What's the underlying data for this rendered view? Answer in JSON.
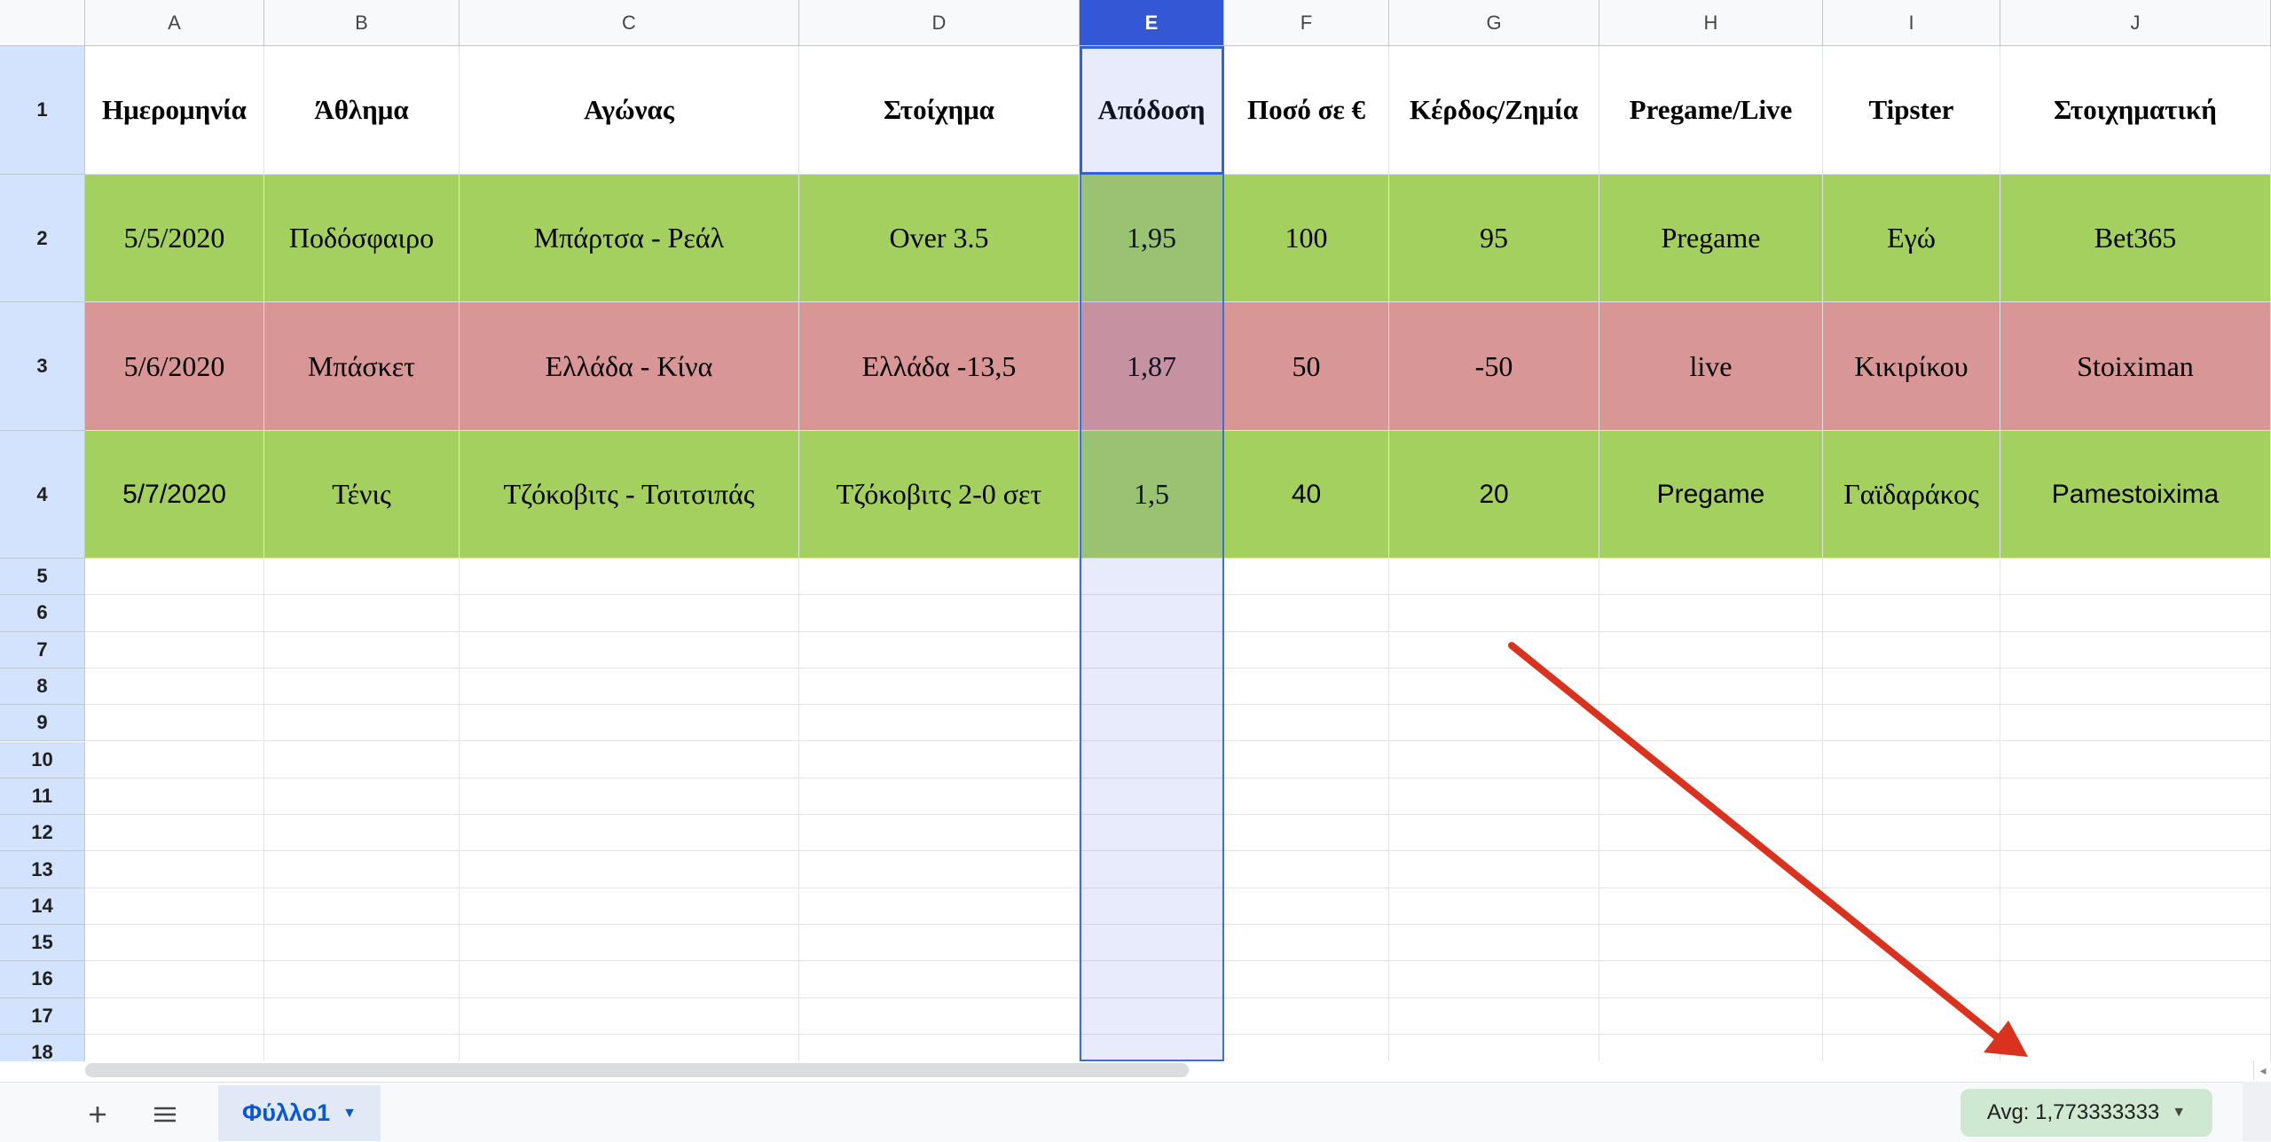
{
  "spreadsheet": {
    "columns": [
      {
        "letter": "A",
        "selected": false
      },
      {
        "letter": "B",
        "selected": false
      },
      {
        "letter": "C",
        "selected": false
      },
      {
        "letter": "D",
        "selected": false
      },
      {
        "letter": "E",
        "selected": true
      },
      {
        "letter": "F",
        "selected": false
      },
      {
        "letter": "G",
        "selected": false
      },
      {
        "letter": "H",
        "selected": false
      },
      {
        "letter": "I",
        "selected": false
      },
      {
        "letter": "J",
        "selected": false
      }
    ],
    "row_numbers": [
      "1",
      "2",
      "3",
      "4",
      "5",
      "6",
      "7",
      "8",
      "9",
      "10",
      "11",
      "12",
      "13",
      "14",
      "15",
      "16",
      "17",
      "18"
    ],
    "header_row": [
      "Ημερομηνία",
      "Άθλημα",
      "Αγώνας",
      "Στοίχημα",
      "Απόδοση",
      "Ποσό σε €",
      "Κέρδος/Ζημία",
      "Pregame/Live",
      "Tipster",
      "Στοιχηματική"
    ],
    "data_rows": [
      {
        "result": "win",
        "fill": "#a3d05f",
        "cells": [
          "5/5/2020",
          "Ποδόσφαιρο",
          "Μπάρτσα - Ρεάλ",
          "Over 3.5",
          "1,95",
          "100",
          "95",
          "Pregame",
          "Εγώ",
          "Bet365"
        ]
      },
      {
        "result": "loss",
        "fill": "#d89696",
        "cells": [
          "5/6/2020",
          "Μπάσκετ",
          "Ελλάδα - Κίνα",
          "Ελλάδα -13,5",
          "1,87",
          "50",
          "-50",
          "live",
          "Κικιρίκου",
          "Stoiximan"
        ]
      },
      {
        "result": "win",
        "fill": "#a3d05f",
        "cells": [
          "5/7/2020",
          "Τένις",
          "Τζόκοβιτς - Τσιτσιπάς",
          "Τζόκοβιτς 2-0 σετ",
          "1,5",
          "40",
          "20",
          "Pregame",
          "Γαϊδαράκος",
          "Pamestoixima"
        ]
      }
    ]
  },
  "footer": {
    "add_sheet_icon": "plus-icon",
    "all_sheets_icon": "menu-icon",
    "sheet_tab_label": "Φύλλο1",
    "summary_label": "Avg: 1,773333333",
    "caret_icon": "caret-down-icon"
  },
  "annotation": {
    "type": "arrow",
    "color": "#d9321f"
  },
  "colors": {
    "selection": "#3457d5",
    "win_fill": "#a3d05f",
    "loss_fill": "#d89696",
    "summary_bg": "#cfe8d1"
  }
}
